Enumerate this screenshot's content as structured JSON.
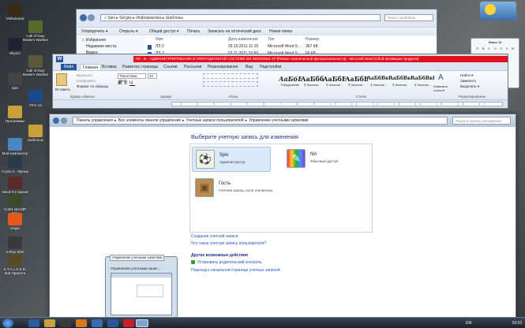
{
  "desktop_icons": [
    {
      "label": "Dishonored",
      "color": "#3a2a1a"
    },
    {
      "label": "Call of Duty Modern Warfare 2",
      "color": "#556b2f"
    },
    {
      "label": "Skyrim",
      "color": "#223"
    },
    {
      "label": "Call of Duty Modern Warfare 3",
      "color": "#5a5a3a"
    },
    {
      "label": "Spiv",
      "color": "#444"
    },
    {
      "label": "FIFA 13",
      "color": "#1a4a8a"
    },
    {
      "label": "Программы",
      "color": "#c9a13b"
    },
    {
      "label": "Шаблоны",
      "color": "#c9a13b"
    },
    {
      "label": "Мой компьютер",
      "color": "#4a86c5"
    },
    {
      "label": "Crysis 2 - Ярлык",
      "color": "#2a3a4a"
    },
    {
      "label": "Need For Speed World",
      "color": "#5a2a2a"
    },
    {
      "label": "CoD4 x64 MP Only",
      "color": "#3a4a2a"
    },
    {
      "label": "Origin",
      "color": "#e05a1a"
    },
    {
      "label": "X-Ray SDK Editor",
      "color": "#3a3a3a"
    },
    {
      "label": "S.T.A.L.K.E.R. Зов Припяти",
      "color": "#5a4a2a"
    }
  ],
  "explorer": {
    "breadcrumb": "« Spiv ▸ Sergey ▸ Информатика ▸ Шаблоны",
    "search_placeholder": "Поиск: Шаблоны",
    "toolbar": [
      "Упорядочить ▾",
      "Открыть ▾",
      "Общий доступ ▾",
      "Печать",
      "Записать на оптический диск",
      "Новая папка"
    ],
    "nav_items": [
      "☆ Избранное",
      "Недавние места",
      "Видео"
    ],
    "columns": [
      "Имя",
      "Дата изменения",
      "Тип",
      "Размер"
    ],
    "rows": [
      {
        "name": "ЛЗ-2",
        "date": "29.10.2011 11:15",
        "type": "Microsoft Word 9...",
        "size": "367 КБ"
      },
      {
        "name": "ЛЗ-3",
        "date": "03.11.2011 10:50",
        "type": "Microsoft Word 9...",
        "size": "66 КБ"
      }
    ]
  },
  "word": {
    "title": "ЛЗ - III - АДМИНИСТРИРОВАНИЕ В ОПЕРАЦИОННОЙ СИСТЕМЕ MS WINDOWS XP [Режим ограниченной функциональности] - Microsoft Word (Сбой активации продукта)",
    "tabs": [
      "Файл",
      "Главная",
      "Вставка",
      "Разметка страницы",
      "Ссылки",
      "Рассылки",
      "Рецензирование",
      "Вид",
      "Надстройки"
    ],
    "clipboard": {
      "paste": "Вставить",
      "cut": "Вырезать",
      "copy": "Копировать",
      "format": "Формат по образцу",
      "group": "Буфер обмена"
    },
    "font": {
      "name": "Times New Rom",
      "size": "12",
      "group": "Шрифт"
    },
    "paragraph_group": "Абзац",
    "styles": [
      {
        "sample": "АаБбВ",
        "name": "¶ Выделение"
      },
      {
        "sample": "АаБбб",
        "name": "¶ Заголов..."
      },
      {
        "sample": "АаБбЕ",
        "name": "¶ Заголов..."
      },
      {
        "sample": "АаБбВ",
        "name": "¶ Заголов..."
      },
      {
        "sample": "АаБбВвГ",
        "name": "¶ Заголов..."
      },
      {
        "sample": "АаБбВвГ",
        "name": "¶ Заголов..."
      },
      {
        "sample": "АаБбВвГ",
        "name": "¶ Заголов..."
      }
    ],
    "styles_group": "Стили",
    "change_styles": "Изменить стили ▾",
    "editing": {
      "find": "Найти ▾",
      "replace": "Заменить",
      "select": "Выделить ▾",
      "group": "Редактирование"
    },
    "ruler": "· 1 · 2 · 3 · 4 · 5 · 6 · 7 · 8 · 9 · 10 · 11 · 12 · 13 · 14 · 15 · 16 · 17 ·"
  },
  "control_panel": {
    "breadcrumb": [
      "Панель управления",
      "▸",
      "Все элементы панели управления",
      "▸",
      "Учетные записи пользователей",
      "▸",
      "Управление учетными записями"
    ],
    "search_placeholder": "Поиск в панели управления",
    "heading": "Выберите учетную запись для изменения",
    "accounts": [
      {
        "name": "Spiv",
        "type": "Администратор",
        "icon": "soccer-ball-icon",
        "glyph": "⚽"
      },
      {
        "name": "NA",
        "type": "Обычный доступ",
        "icon": "crayons-icon",
        "glyph": "✎"
      },
      {
        "name": "Гость",
        "type": "Учетная запись гостя отключена",
        "icon": "briefcase-icon",
        "glyph": "▣"
      }
    ],
    "create_link": "Создание учетной записи",
    "what_link": "Что такое учетная запись пользователя?",
    "additional_heading": "Другие возможные действия",
    "parental_link": "Установить родительский контроль",
    "home_link": "Переход к начальной странице учетных записей"
  },
  "thumbnail": {
    "tooltip": "Управление учетными записями",
    "title": "Управление учетными запис..."
  },
  "calendar": {
    "header": "Июнь 11",
    "days": [
      "П",
      "В",
      "С",
      "Ч",
      "П",
      "С",
      "В"
    ]
  },
  "taskbar": {
    "lang": "EN",
    "time": "10:10"
  },
  "colors": {
    "accent": "#1e57c7",
    "title_alert": "#e2101b",
    "heading": "#1e3287"
  }
}
